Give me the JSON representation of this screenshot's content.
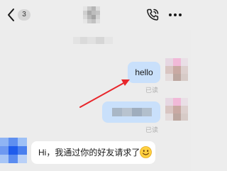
{
  "header": {
    "unread_count": "3",
    "icons": {
      "back": "chevron-left-icon",
      "call": "phone-call-icon",
      "more": "more-dots-icon"
    }
  },
  "messages": [
    {
      "direction": "outgoing",
      "text": "hello",
      "status": "已读"
    },
    {
      "direction": "outgoing",
      "text": "",
      "status": "已读"
    },
    {
      "direction": "incoming",
      "text": "Hi，我通过你的好友请求了",
      "emoji": "smiley-emoji-icon"
    }
  ],
  "colors": {
    "background": "#ededed",
    "outgoing_bubble": "#c9e0fb",
    "incoming_bubble": "#ffffff",
    "annotation_arrow": "#e8262b",
    "status_text": "#b0b0b0"
  }
}
